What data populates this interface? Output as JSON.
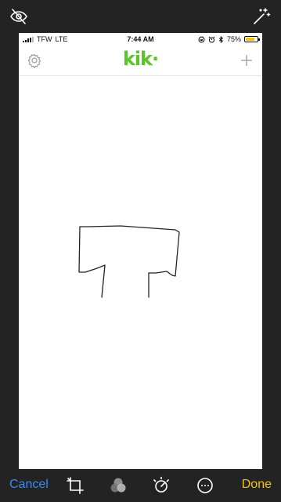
{
  "editor": {
    "top": {
      "visibility_icon": "eye-slash-icon",
      "auto_enhance_icon": "magic-wand-icon"
    },
    "bottom": {
      "cancel_label": "Cancel",
      "done_label": "Done",
      "tools": [
        "crop-rotate-icon",
        "filters-icon",
        "adjust-icon",
        "more-icon"
      ]
    },
    "colors": {
      "background": "#232323",
      "cancel": "#2d8cff",
      "done": "#f5c400"
    }
  },
  "screenshot": {
    "status_bar": {
      "carrier": "TFW",
      "network": "LTE",
      "time": "7:44 AM",
      "battery_percent_label": "75%",
      "battery_level": 0.75,
      "icons": [
        "rotation-lock-icon",
        "alarm-icon",
        "bluetooth-icon"
      ]
    },
    "app": {
      "logo": "kik·",
      "brand_color": "#5ac42a",
      "left_icon": "gear-icon",
      "right_icon": "plus-icon"
    },
    "drawing": {
      "description_shape": "hand-drawn-T"
    }
  }
}
